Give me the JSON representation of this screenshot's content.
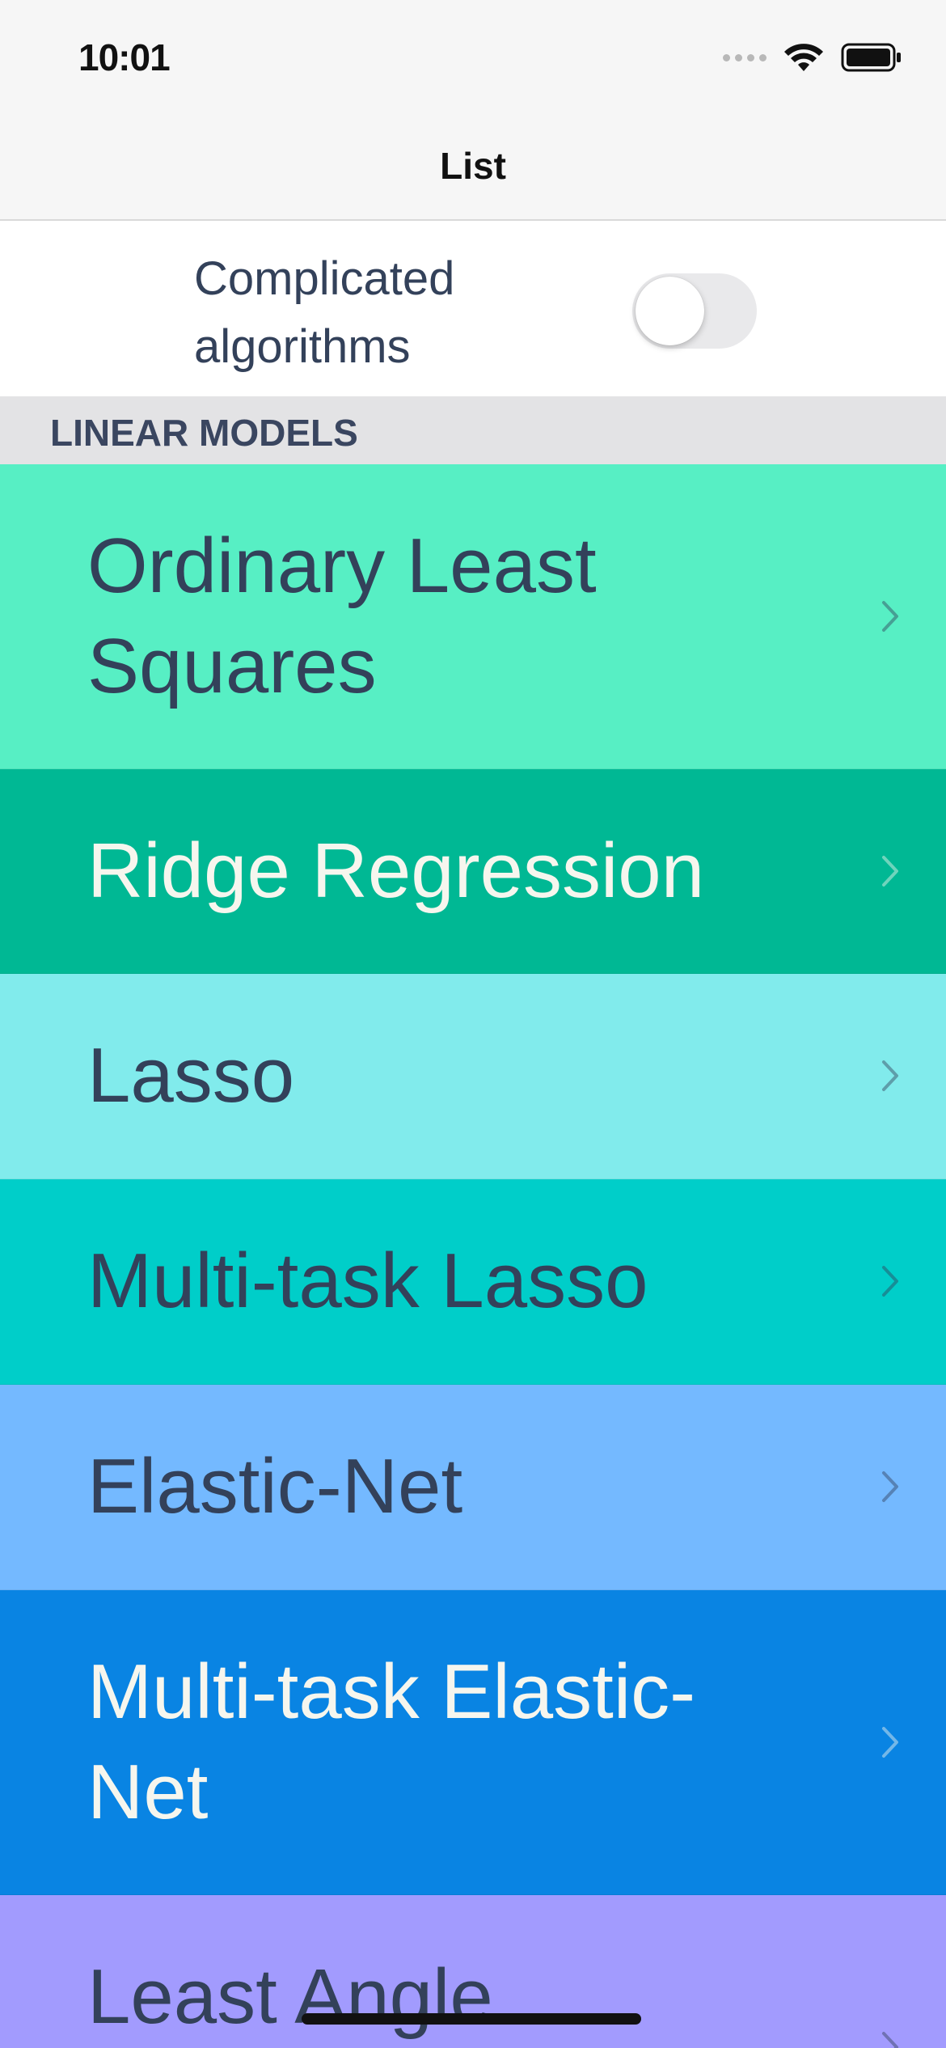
{
  "status_bar": {
    "time": "10:01",
    "icons": [
      "signal-dots-icon",
      "wifi-icon",
      "battery-icon"
    ]
  },
  "nav": {
    "title": "List"
  },
  "toggle": {
    "label": "Complicated algorithms",
    "on": false
  },
  "section": {
    "title": "LINEAR MODELS"
  },
  "items": [
    {
      "label": "Ordinary Least Squares",
      "bg": "#57efc4",
      "text": "#33415a"
    },
    {
      "label": "Ridge Regression",
      "bg": "#00b894",
      "text": "#f6f6ee"
    },
    {
      "label": "Lasso",
      "bg": "#81ebec",
      "text": "#33415a"
    },
    {
      "label": "Multi-task Lasso",
      "bg": "#00cec9",
      "text": "#33415a"
    },
    {
      "label": "Elastic-Net",
      "bg": "#74b9ff",
      "text": "#33415a"
    },
    {
      "label": "Multi-task Elastic-Net",
      "bg": "#0984e3",
      "text": "#f6f6ee"
    },
    {
      "label": "Least Angle",
      "bg": "#a29bfe",
      "text": "#33415a"
    }
  ]
}
